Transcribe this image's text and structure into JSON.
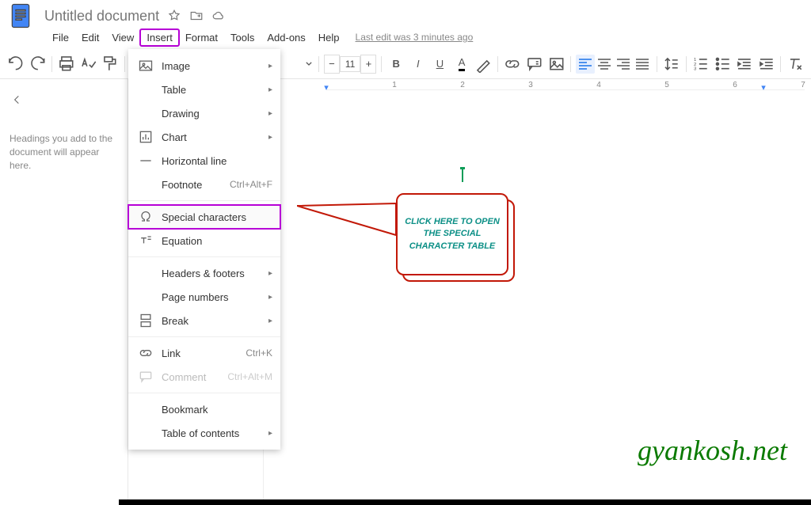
{
  "title": "Untitled document",
  "menubar": {
    "file": "File",
    "edit": "Edit",
    "view": "View",
    "insert": "Insert",
    "format": "Format",
    "tools": "Tools",
    "addons": "Add-ons",
    "help": "Help",
    "last_edit": "Last edit was 3 minutes ago"
  },
  "toolbar": {
    "fontsize": "11"
  },
  "ruler": {
    "t1": "1",
    "t2": "2",
    "t3": "3",
    "t4": "4",
    "t5": "5",
    "t6": "6",
    "t7": "7"
  },
  "outline": {
    "hint": "Headings you add to the document will appear here."
  },
  "insert_menu": {
    "image": "Image",
    "table": "Table",
    "drawing": "Drawing",
    "chart": "Chart",
    "hr": "Horizontal line",
    "footnote": "Footnote",
    "footnote_k": "Ctrl+Alt+F",
    "special": "Special characters",
    "equation": "Equation",
    "headers_footers": "Headers & footers",
    "page_numbers": "Page numbers",
    "break": "Break",
    "link": "Link",
    "link_k": "Ctrl+K",
    "comment": "Comment",
    "comment_k": "Ctrl+Alt+M",
    "bookmark": "Bookmark",
    "toc": "Table of contents"
  },
  "callout": {
    "line1": "CLICK HERE TO OPEN",
    "line2": "THE SPECIAL",
    "line3": "CHARACTER TABLE"
  },
  "watermark": "gyankosh.net"
}
